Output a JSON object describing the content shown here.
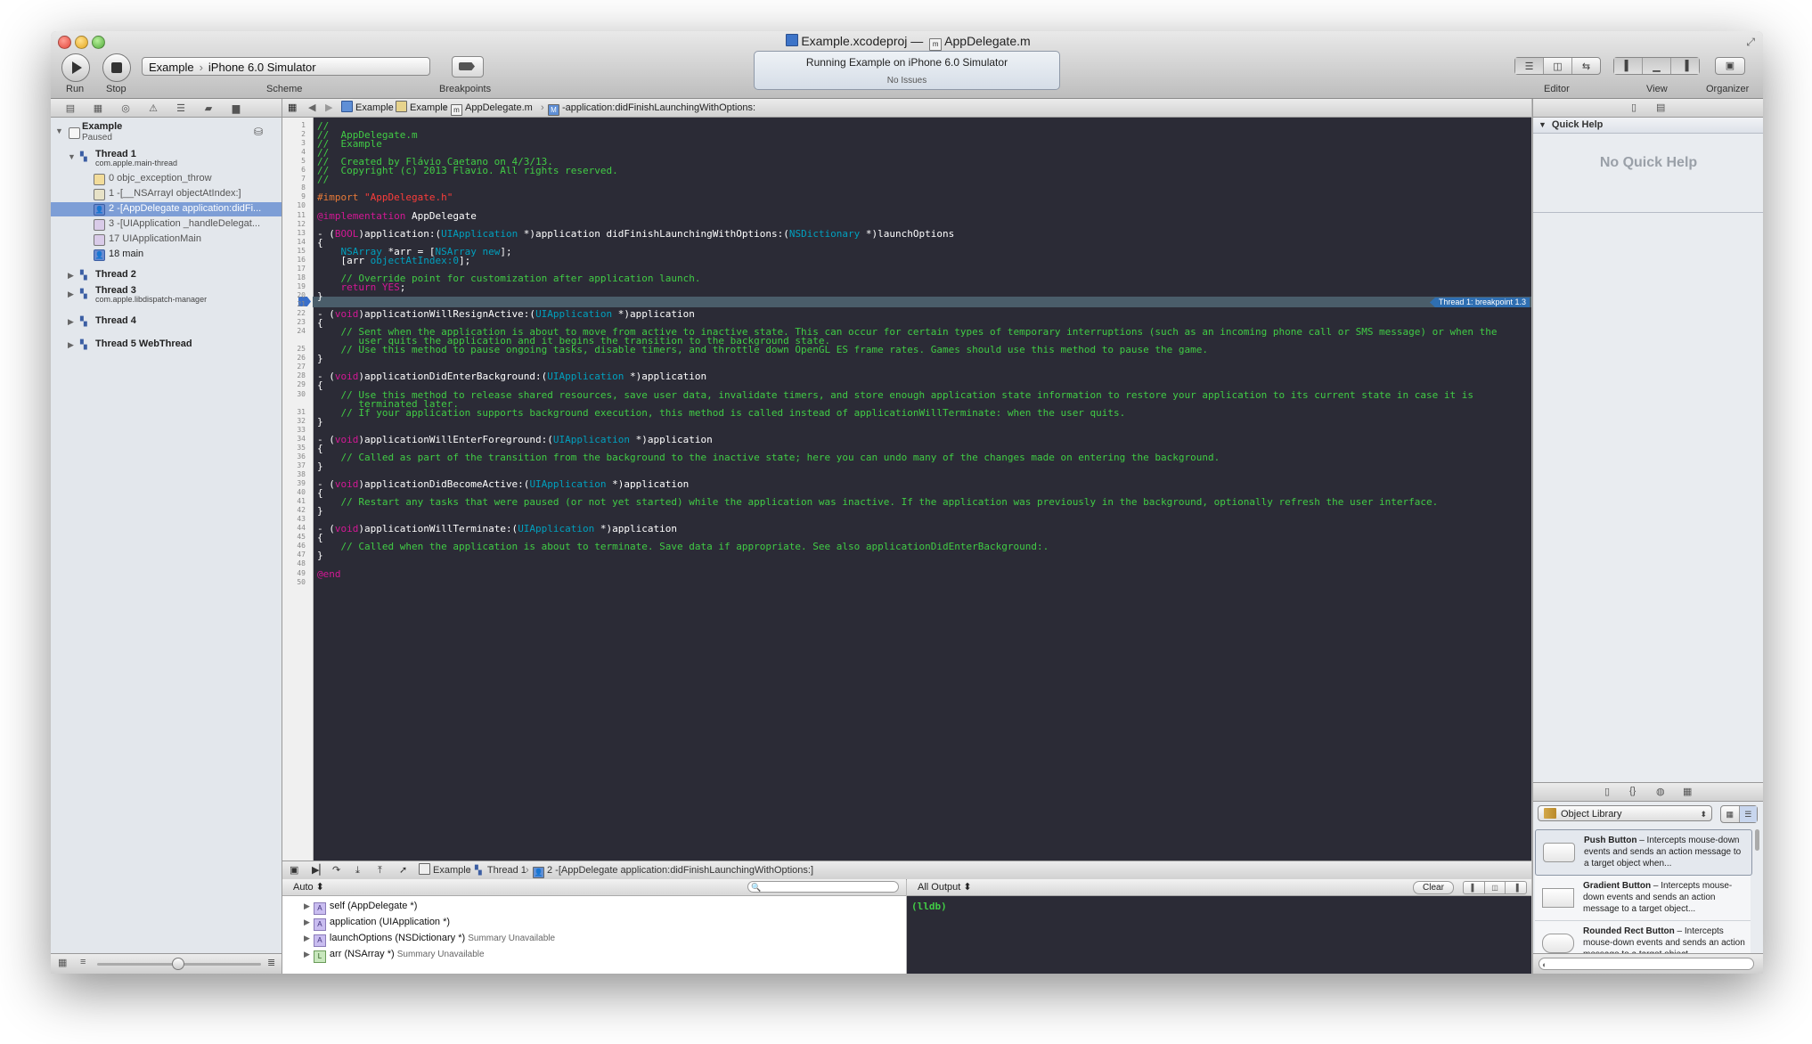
{
  "window": {
    "title_project": "Example.xcodeproj",
    "title_separator": "—",
    "title_file": "AppDelegate.m"
  },
  "toolbar": {
    "run_label": "Run",
    "stop_label": "Stop",
    "scheme_target": "Example",
    "scheme_device": "iPhone 6.0 Simulator",
    "scheme_label": "Scheme",
    "breakpoints_label": "Breakpoints",
    "status_text": "Running Example on iPhone 6.0 Simulator",
    "status_sub": "No Issues",
    "editor_label": "Editor",
    "view_label": "View",
    "organizer_label": "Organizer"
  },
  "navigator": {
    "process_name": "Example",
    "process_state": "Paused",
    "threads": [
      {
        "name": "Thread 1",
        "queue": "com.apple.main-thread"
      },
      {
        "name": "Thread 2",
        "queue": ""
      },
      {
        "name": "Thread 3",
        "queue": "com.apple.libdispatch-manager"
      },
      {
        "name": "Thread 4",
        "queue": ""
      },
      {
        "name": "Thread 5 WebThread",
        "queue": ""
      }
    ],
    "frames": [
      "0 objc_exception_throw",
      "1 -[__NSArrayI objectAtIndex:]",
      "2 -[AppDelegate application:didFi...",
      "3 -[UIApplication _handleDelegat...",
      "17 UIApplicationMain",
      "18 main"
    ]
  },
  "jumpbar": {
    "crumbs": [
      "Example",
      "Example",
      "AppDelegate.m",
      "-application:didFinishLaunchingWithOptions:"
    ]
  },
  "editor": {
    "breakpoint_label": "Thread 1: breakpoint 1.3"
  },
  "debug": {
    "crumbs": [
      "Example",
      "Thread 1",
      "2 -[AppDelegate application:didFinishLaunchingWithOptions:]"
    ],
    "auto_label": "Auto ⬍",
    "all_output_label": "All Output ⬍",
    "clear_label": "Clear",
    "lldb_prompt": "(lldb)",
    "variables": [
      {
        "name": "self",
        "type": "(AppDelegate *)",
        "summary": "",
        "badge": "A"
      },
      {
        "name": "application",
        "type": "(UIApplication *)",
        "summary": "",
        "badge": "A"
      },
      {
        "name": "launchOptions",
        "type": "(NSDictionary *)",
        "summary": "Summary Unavailable",
        "badge": "A"
      },
      {
        "name": "arr",
        "type": "(NSArray *)",
        "summary": "Summary Unavailable",
        "badge": "L"
      }
    ]
  },
  "utilities": {
    "quick_help_title": "Quick Help",
    "no_quick_help": "No Quick Help",
    "library_name": "Object Library",
    "library_items": [
      {
        "title": "Push Button",
        "desc": " – Intercepts mouse-down events and sends an action message to a target object when..."
      },
      {
        "title": "Gradient Button",
        "desc": " – Intercepts mouse-down events and sends an action message to a target object..."
      },
      {
        "title": "Rounded Rect Button",
        "desc": " – Intercepts mouse-down events and sends an action message to a target object..."
      }
    ]
  },
  "code_lines": [
    [
      [
        "c-com",
        "//"
      ]
    ],
    [
      [
        "c-com",
        "//  AppDelegate.m"
      ]
    ],
    [
      [
        "c-com",
        "//  Example"
      ]
    ],
    [
      [
        "c-com",
        "//"
      ]
    ],
    [
      [
        "c-com",
        "//  Created by Flávio Caetano on 4/3/13."
      ]
    ],
    [
      [
        "c-com",
        "//  Copyright (c) 2013 Flavio. All rights reserved."
      ]
    ],
    [
      [
        "c-com",
        "//"
      ]
    ],
    [],
    [
      [
        "c-pp",
        "#import "
      ],
      [
        "c-str",
        "\"AppDelegate.h\""
      ]
    ],
    [],
    [
      [
        "c-key",
        "@implementation"
      ],
      [
        "c-plain",
        " AppDelegate"
      ]
    ],
    [],
    [
      [
        "c-plain",
        "- ("
      ],
      [
        "c-key",
        "BOOL"
      ],
      [
        "c-plain",
        ")application:("
      ],
      [
        "c-type",
        "UIApplication"
      ],
      [
        "c-plain",
        " *)application didFinishLaunchingWithOptions:("
      ],
      [
        "c-type",
        "NSDictionary"
      ],
      [
        "c-plain",
        " *)launchOptions"
      ]
    ],
    [
      [
        "c-plain",
        "{"
      ]
    ],
    [
      [
        "c-plain",
        "    "
      ],
      [
        "c-type",
        "NSArray"
      ],
      [
        "c-plain",
        " *arr = ["
      ],
      [
        "c-type",
        "NSArray"
      ],
      [
        "c-plain",
        " "
      ],
      [
        "c-type",
        "new"
      ],
      [
        "c-plain",
        "];"
      ]
    ],
    [
      [
        "c-plain",
        "    [arr "
      ],
      [
        "c-type",
        "objectAtIndex:"
      ],
      [
        "c-type",
        "0"
      ],
      [
        "c-plain",
        "];"
      ]
    ],
    [],
    [
      [
        "c-com",
        "    // Override point for customization after application launch."
      ]
    ],
    [
      [
        "c-plain",
        "    "
      ],
      [
        "c-key",
        "return"
      ],
      [
        "c-plain",
        " "
      ],
      [
        "c-key",
        "YES"
      ],
      [
        "c-plain",
        ";"
      ]
    ],
    [
      [
        "c-plain",
        "}"
      ]
    ],
    [],
    [
      [
        "c-plain",
        "- ("
      ],
      [
        "c-key",
        "void"
      ],
      [
        "c-plain",
        ")applicationWillResignActive:("
      ],
      [
        "c-type",
        "UIApplication"
      ],
      [
        "c-plain",
        " *)application"
      ]
    ],
    [
      [
        "c-plain",
        "{"
      ]
    ],
    [
      [
        "c-com",
        "    // Sent when the application is about to move from active to inactive state. This can occur for certain types of temporary interruptions (such as an incoming phone call or SMS message) or when the"
      ]
    ],
    [
      [
        "c-com",
        "       user quits the application and it begins the transition to the background state."
      ]
    ],
    [
      [
        "c-com",
        "    // Use this method to pause ongoing tasks, disable timers, and throttle down OpenGL ES frame rates. Games should use this method to pause the game."
      ]
    ],
    [
      [
        "c-plain",
        "}"
      ]
    ],
    [],
    [
      [
        "c-plain",
        "- ("
      ],
      [
        "c-key",
        "void"
      ],
      [
        "c-plain",
        ")applicationDidEnterBackground:("
      ],
      [
        "c-type",
        "UIApplication"
      ],
      [
        "c-plain",
        " *)application"
      ]
    ],
    [
      [
        "c-plain",
        "{"
      ]
    ],
    [
      [
        "c-com",
        "    // Use this method to release shared resources, save user data, invalidate timers, and store enough application state information to restore your application to its current state in case it is"
      ]
    ],
    [
      [
        "c-com",
        "       terminated later."
      ]
    ],
    [
      [
        "c-com",
        "    // If your application supports background execution, this method is called instead of applicationWillTerminate: when the user quits."
      ]
    ],
    [
      [
        "c-plain",
        "}"
      ]
    ],
    [],
    [
      [
        "c-plain",
        "- ("
      ],
      [
        "c-key",
        "void"
      ],
      [
        "c-plain",
        ")applicationWillEnterForeground:("
      ],
      [
        "c-type",
        "UIApplication"
      ],
      [
        "c-plain",
        " *)application"
      ]
    ],
    [
      [
        "c-plain",
        "{"
      ]
    ],
    [
      [
        "c-com",
        "    // Called as part of the transition from the background to the inactive state; here you can undo many of the changes made on entering the background."
      ]
    ],
    [
      [
        "c-plain",
        "}"
      ]
    ],
    [],
    [
      [
        "c-plain",
        "- ("
      ],
      [
        "c-key",
        "void"
      ],
      [
        "c-plain",
        ")applicationDidBecomeActive:("
      ],
      [
        "c-type",
        "UIApplication"
      ],
      [
        "c-plain",
        " *)application"
      ]
    ],
    [
      [
        "c-plain",
        "{"
      ]
    ],
    [
      [
        "c-com",
        "    // Restart any tasks that were paused (or not yet started) while the application was inactive. If the application was previously in the background, optionally refresh the user interface."
      ]
    ],
    [
      [
        "c-plain",
        "}"
      ]
    ],
    [],
    [
      [
        "c-plain",
        "- ("
      ],
      [
        "c-key",
        "void"
      ],
      [
        "c-plain",
        ")applicationWillTerminate:("
      ],
      [
        "c-type",
        "UIApplication"
      ],
      [
        "c-plain",
        " *)application"
      ]
    ],
    [
      [
        "c-plain",
        "{"
      ]
    ],
    [
      [
        "c-com",
        "    // Called when the application is about to terminate. Save data if appropriate. See also applicationDidEnterBackground:."
      ]
    ],
    [
      [
        "c-plain",
        "}"
      ]
    ],
    [],
    [
      [
        "c-key",
        "@end"
      ]
    ]
  ],
  "line_numbers": [
    "1",
    "2",
    "3",
    "4",
    "5",
    "6",
    "7",
    "8",
    "9",
    "10",
    "11",
    "12",
    "13",
    "14",
    "15",
    "16",
    "17",
    "18",
    "19",
    "20",
    "21",
    "22",
    "23",
    "24",
    "",
    "25",
    "26",
    "27",
    "28",
    "29",
    "30",
    "",
    "31",
    "32",
    "33",
    "34",
    "35",
    "36",
    "37",
    "38",
    "39",
    "40",
    "41",
    "42",
    "43",
    "44",
    "45",
    "46",
    "47",
    "48",
    "49",
    "50"
  ]
}
